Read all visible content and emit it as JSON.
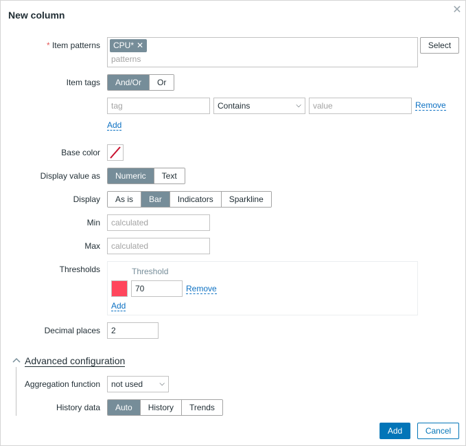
{
  "dialog": {
    "title": "New column",
    "close_icon": "close-icon"
  },
  "item_patterns": {
    "label": "Item patterns",
    "required_mark": "*",
    "chips": [
      {
        "text": "CPU*"
      }
    ],
    "placeholder": "patterns",
    "select_label": "Select"
  },
  "item_tags": {
    "label": "Item tags",
    "toggle": [
      {
        "label": "And/Or",
        "active": true
      },
      {
        "label": "Or",
        "active": false
      }
    ],
    "row": {
      "tag_placeholder": "tag",
      "operator": "Contains",
      "value_placeholder": "value",
      "remove_label": "Remove"
    },
    "add_label": "Add"
  },
  "base_color": {
    "label": "Base color",
    "icon": "no-color-icon"
  },
  "display_value_as": {
    "label": "Display value as",
    "options": [
      {
        "label": "Numeric",
        "active": true
      },
      {
        "label": "Text",
        "active": false
      }
    ]
  },
  "display": {
    "label": "Display",
    "options": [
      {
        "label": "As is",
        "active": false
      },
      {
        "label": "Bar",
        "active": true
      },
      {
        "label": "Indicators",
        "active": false
      },
      {
        "label": "Sparkline",
        "active": false
      }
    ]
  },
  "min": {
    "label": "Min",
    "placeholder": "calculated"
  },
  "max": {
    "label": "Max",
    "placeholder": "calculated"
  },
  "thresholds": {
    "label": "Thresholds",
    "column_header": "Threshold",
    "rows": [
      {
        "color": "#ff465c",
        "value": "70",
        "remove_label": "Remove"
      }
    ],
    "add_label": "Add"
  },
  "decimal_places": {
    "label": "Decimal places",
    "value": "2"
  },
  "advanced": {
    "title": "Advanced configuration",
    "aggregation": {
      "label": "Aggregation function",
      "value": "not used"
    },
    "history": {
      "label": "History data",
      "options": [
        {
          "label": "Auto",
          "active": true
        },
        {
          "label": "History",
          "active": false
        },
        {
          "label": "Trends",
          "active": false
        }
      ]
    }
  },
  "footer": {
    "add_label": "Add",
    "cancel_label": "Cancel"
  },
  "colors": {
    "accent": "#0275b8",
    "toggle_active": "#768d99",
    "required": "#e45959"
  }
}
